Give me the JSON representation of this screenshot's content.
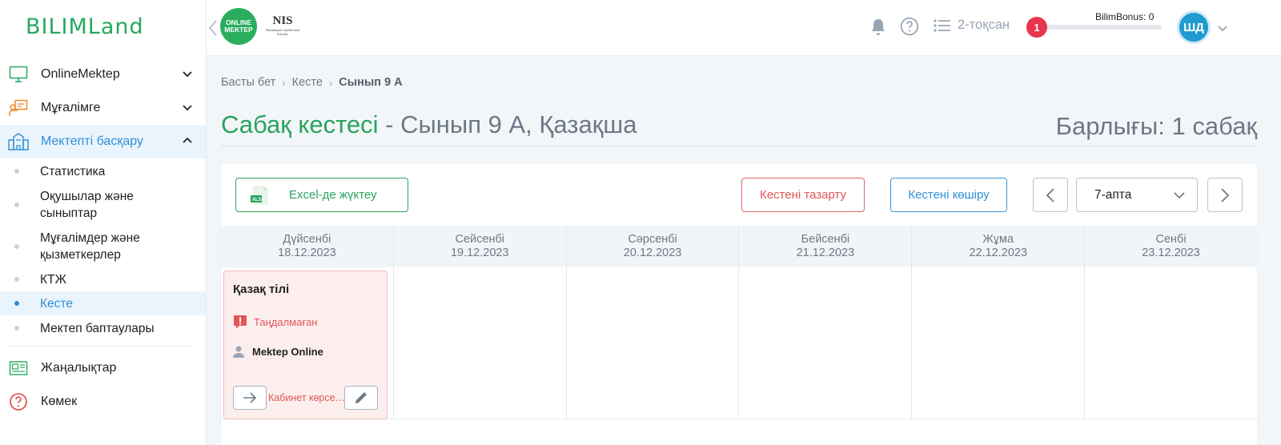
{
  "app": {
    "logo_text": "BILIMLand"
  },
  "sidebar": {
    "items": [
      {
        "label": "OnlineMektep",
        "icon": "monitor-icon"
      },
      {
        "label": "Мұғалімге",
        "icon": "teacher-board-icon"
      },
      {
        "label": "Мектепті басқару",
        "icon": "school-building-icon"
      }
    ],
    "sub_items": [
      {
        "label": "Статистика"
      },
      {
        "label": "Оқушылар және сыныптар"
      },
      {
        "label": "Мұғалімдер және қызметкерлер"
      },
      {
        "label": "КТЖ"
      },
      {
        "label": "Кесте"
      },
      {
        "label": "Мектеп баптаулары"
      }
    ],
    "bottom_items": [
      {
        "label": "Жаңалықтар",
        "icon": "news-icon"
      },
      {
        "label": "Көмек",
        "icon": "help-circle-icon"
      }
    ]
  },
  "header": {
    "brand1_text": "ONLINE MEKTEP",
    "brand2_text": "NIS",
    "brand2_sub": "Nazarbayev Intellectual Schools",
    "quarter": "2-тоқсан",
    "notification_count": "1",
    "bonus_label": "BilimBonus: 0",
    "bonus_progress": 0,
    "avatar_initials": "ШД"
  },
  "breadcrumb": [
    "Басты бет",
    "Кесте",
    "Сынып 9 А"
  ],
  "title": {
    "main": "Сабақ кестесі",
    "rest": " - Сынып 9 А, Қазақша"
  },
  "total": "Барлығы: 1 сабақ",
  "toolbar": {
    "excel_label": "Excel-де жүктеу",
    "clear_label": "Кестені тазарту",
    "copy_label": "Кестені көшіру",
    "week_value": "7-апта"
  },
  "days": [
    {
      "name": "Дүйсенбі",
      "date": "18.12.2023"
    },
    {
      "name": "Сейсенбі",
      "date": "19.12.2023"
    },
    {
      "name": "Сәрсенбі",
      "date": "20.12.2023"
    },
    {
      "name": "Бейсенбі",
      "date": "21.12.2023"
    },
    {
      "name": "Жұма",
      "date": "22.12.2023"
    },
    {
      "name": "Сенбі",
      "date": "23.12.2023"
    }
  ],
  "lesson": {
    "subject": "Қазақ тілі",
    "status": "Таңдалмаған",
    "teacher": "Mektep Online",
    "room": "Кабинет көрсетілмеген"
  },
  "colors": {
    "accent_green": "#28a35f",
    "accent_blue": "#2f8fd8",
    "danger": "#e05757"
  }
}
